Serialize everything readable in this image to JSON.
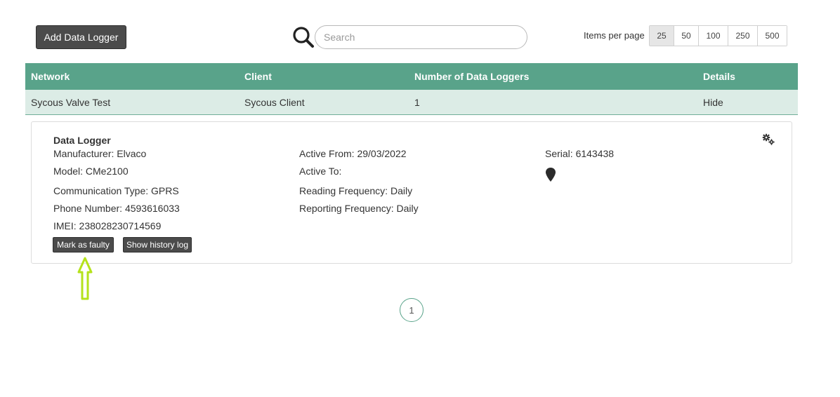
{
  "toolbar": {
    "add_label": "Add Data Logger",
    "search_placeholder": "Search",
    "search_icon": "search-icon",
    "items_per_page_label": "Items per page",
    "items_per_page_options": [
      "25",
      "50",
      "100",
      "250",
      "500"
    ],
    "items_per_page_selected": "25"
  },
  "table": {
    "headers": [
      "Network",
      "Client",
      "Number of Data Loggers",
      "Details"
    ],
    "rows": [
      [
        "Sycous Valve Test",
        "Sycous Client",
        "1",
        "Hide"
      ]
    ],
    "header_color": "#59a38a",
    "row_color": "#dcece6"
  },
  "detail": {
    "title": "Data Logger",
    "manufacturer": "Manufacturer: Elvaco",
    "model": "Model: CMe2100",
    "communication_type": "Communication Type: GPRS",
    "phone_number": "Phone Number: 4593616033",
    "imei": "IMEI: 238028230714569",
    "active_from": "Active From: 29/03/2022",
    "active_to": "Active To:",
    "reading_frequency": "Reading Frequency: Daily",
    "reporting_frequency": "Reporting Frequency: Daily",
    "serial": "Serial: 6143438",
    "mark_faulty_label": "Mark as faulty",
    "history_label": "Show history log",
    "settings_icon": "gears-icon",
    "location_icon": "map-pin-icon"
  },
  "annotation": {
    "icon": "up-arrow-icon",
    "color": "#b5e21b"
  },
  "pagination": {
    "current_page": "1"
  }
}
